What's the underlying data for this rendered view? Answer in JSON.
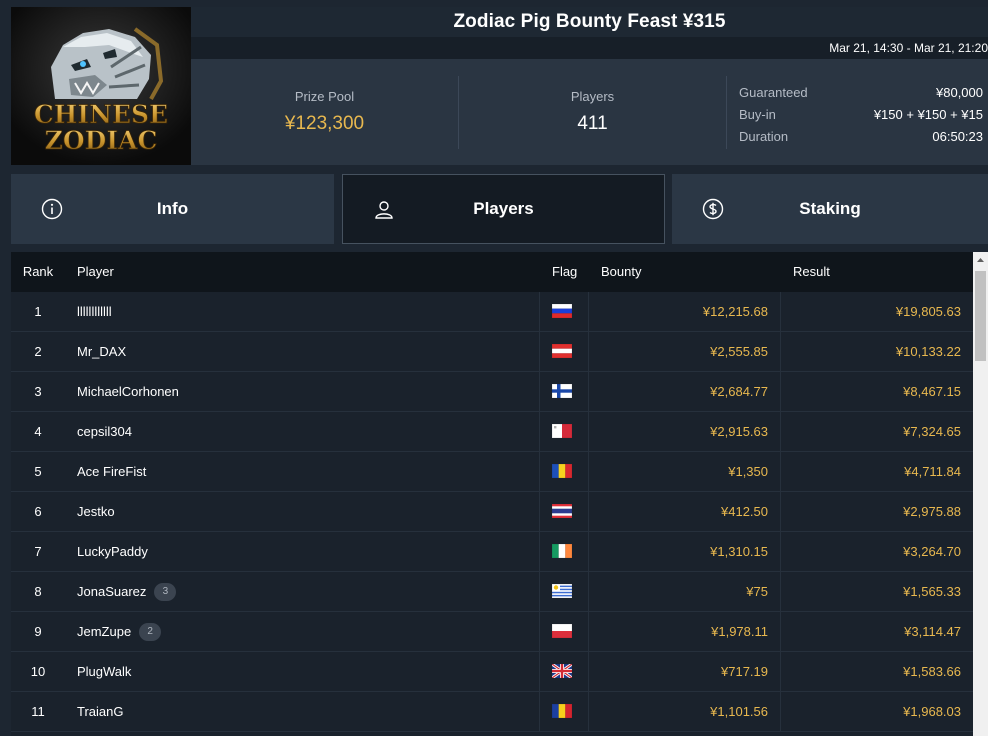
{
  "tournament": {
    "title": "Zodiac Pig Bounty Feast ¥315",
    "dates": "Mar 21, 14:30 - Mar 21, 21:20",
    "logo": {
      "line1": "CHINESE",
      "line2": "ZODIAC"
    }
  },
  "stats": {
    "prize_pool_label": "Prize Pool",
    "prize_pool_value": "¥123,300",
    "players_label": "Players",
    "players_value": "411"
  },
  "details": [
    {
      "label": "Guaranteed",
      "value": "¥80,000"
    },
    {
      "label": "Buy-in",
      "value": "¥150 + ¥150 + ¥15"
    },
    {
      "label": "Duration",
      "value": "06:50:23"
    }
  ],
  "tabs": [
    {
      "label": "Info",
      "icon": "info-icon",
      "active": false
    },
    {
      "label": "Players",
      "icon": "user-icon",
      "active": true
    },
    {
      "label": "Staking",
      "icon": "coin-dollar-icon",
      "active": false
    }
  ],
  "table": {
    "columns": {
      "rank": "Rank",
      "player": "Player",
      "flag": "Flag",
      "bounty": "Bounty",
      "result": "Result"
    },
    "rows": [
      {
        "rank": "1",
        "player": "llllllllllll",
        "flag": "ru",
        "bounty": "¥12,215.68",
        "result": "¥19,805.63"
      },
      {
        "rank": "2",
        "player": "Mr_DAX",
        "flag": "at",
        "bounty": "¥2,555.85",
        "result": "¥10,133.22"
      },
      {
        "rank": "3",
        "player": "MichaelCorhonen",
        "flag": "fi",
        "bounty": "¥2,684.77",
        "result": "¥8,467.15"
      },
      {
        "rank": "4",
        "player": "cepsil304",
        "flag": "mt",
        "bounty": "¥2,915.63",
        "result": "¥7,324.65"
      },
      {
        "rank": "5",
        "player": "Ace FireFist",
        "flag": "md",
        "bounty": "¥1,350",
        "result": "¥4,711.84"
      },
      {
        "rank": "6",
        "player": "Jestko",
        "flag": "th",
        "bounty": "¥412.50",
        "result": "¥2,975.88"
      },
      {
        "rank": "7",
        "player": "LuckyPaddy",
        "flag": "ie",
        "bounty": "¥1,310.15",
        "result": "¥3,264.70"
      },
      {
        "rank": "8",
        "player": "JonaSuarez",
        "badge": "3",
        "flag": "uy",
        "bounty": "¥75",
        "result": "¥1,565.33"
      },
      {
        "rank": "9",
        "player": "JemZupe",
        "badge": "2",
        "flag": "pl",
        "bounty": "¥1,978.11",
        "result": "¥3,114.47"
      },
      {
        "rank": "10",
        "player": "PlugWalk",
        "flag": "gb",
        "bounty": "¥717.19",
        "result": "¥1,583.66"
      },
      {
        "rank": "11",
        "player": "TraianG",
        "flag": "ro",
        "bounty": "¥1,101.56",
        "result": "¥1,968.03"
      }
    ]
  },
  "colors": {
    "accent_gold": "#e8b84f",
    "panel": "#2a3542",
    "background": "#1d2631"
  }
}
